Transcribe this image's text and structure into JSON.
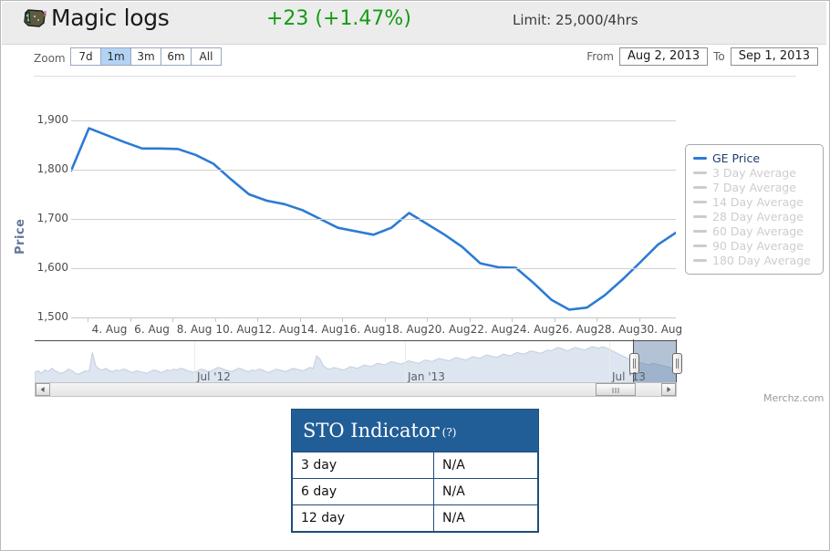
{
  "header": {
    "item_name": "Magic logs",
    "item_icon": "magic-logs-icon",
    "change": "+23 (+1.47%)",
    "change_color": "#149b14",
    "limit": "Limit: 25,000/4hrs"
  },
  "toolbar": {
    "zoom_label": "Zoom",
    "zoom_buttons": [
      {
        "label": "7d",
        "active": false
      },
      {
        "label": "1m",
        "active": true
      },
      {
        "label": "3m",
        "active": false
      },
      {
        "label": "6m",
        "active": false
      },
      {
        "label": "All",
        "active": false
      }
    ],
    "from_label": "From",
    "from_value": "Aug 2, 2013",
    "to_label": "To",
    "to_value": "Sep 1, 2013"
  },
  "legend": {
    "items": [
      {
        "label": "GE Price",
        "color": "#2b7bd4",
        "active": true
      },
      {
        "label": "3 Day Average",
        "color": "#cccccc",
        "active": false
      },
      {
        "label": "7 Day Average",
        "color": "#cccccc",
        "active": false
      },
      {
        "label": "14 Day Average",
        "color": "#cccccc",
        "active": false
      },
      {
        "label": "28 Day Average",
        "color": "#cccccc",
        "active": false
      },
      {
        "label": "60 Day Average",
        "color": "#cccccc",
        "active": false
      },
      {
        "label": "90 Day Average",
        "color": "#cccccc",
        "active": false
      },
      {
        "label": "180 Day Average",
        "color": "#cccccc",
        "active": false
      }
    ]
  },
  "navigator": {
    "labels": [
      "Jul '12",
      "Jan '13",
      "Jul '13"
    ],
    "selection_start_pct": 93.2,
    "selection_end_pct": 100
  },
  "watermark": "Merchz.com",
  "sto": {
    "title": "STO Indicator",
    "help": "(?)",
    "rows": [
      {
        "period": "3 day",
        "value": "N/A"
      },
      {
        "period": "6 day",
        "value": "N/A"
      },
      {
        "period": "12 day",
        "value": "N/A"
      }
    ]
  },
  "chart_data": {
    "type": "line",
    "title": "",
    "xlabel": "",
    "ylabel": "Price",
    "ylim": [
      1500,
      1900
    ],
    "yticks": [
      "1,500",
      "1,600",
      "1,700",
      "1,800",
      "1,900"
    ],
    "ytick_values": [
      1500,
      1600,
      1700,
      1800,
      1900
    ],
    "xticks": [
      "4. Aug",
      "6. Aug",
      "8. Aug",
      "10. Aug",
      "12. Aug",
      "14. Aug",
      "16. Aug",
      "18. Aug",
      "20. Aug",
      "22. Aug",
      "24. Aug",
      "26. Aug",
      "28. Aug",
      "30. Aug"
    ],
    "grid": true,
    "legend_position": "right",
    "series": [
      {
        "name": "GE Price",
        "color": "#2b7bd4",
        "x": [
          "2. Aug",
          "3. Aug",
          "4. Aug",
          "5. Aug",
          "6. Aug",
          "7. Aug",
          "8. Aug",
          "9. Aug",
          "10. Aug",
          "11. Aug",
          "12. Aug",
          "13. Aug",
          "14. Aug",
          "15. Aug",
          "16. Aug",
          "17. Aug",
          "18. Aug",
          "19. Aug",
          "20. Aug",
          "21. Aug",
          "22. Aug",
          "23. Aug",
          "24. Aug",
          "25. Aug",
          "26. Aug",
          "27. Aug",
          "28. Aug",
          "29. Aug",
          "30. Aug",
          "31. Aug",
          "1. Sep"
        ],
        "values": [
          1798,
          1884,
          1870,
          1856,
          1843,
          1843,
          1842,
          1830,
          1812,
          1780,
          1750,
          1737,
          1730,
          1718,
          1700,
          1682,
          1675,
          1668,
          1682,
          1712,
          1690,
          1668,
          1643,
          1610,
          1602,
          1601,
          1570,
          1536,
          1516,
          1520,
          1545,
          1577,
          1612,
          1648,
          1672
        ]
      }
    ]
  }
}
